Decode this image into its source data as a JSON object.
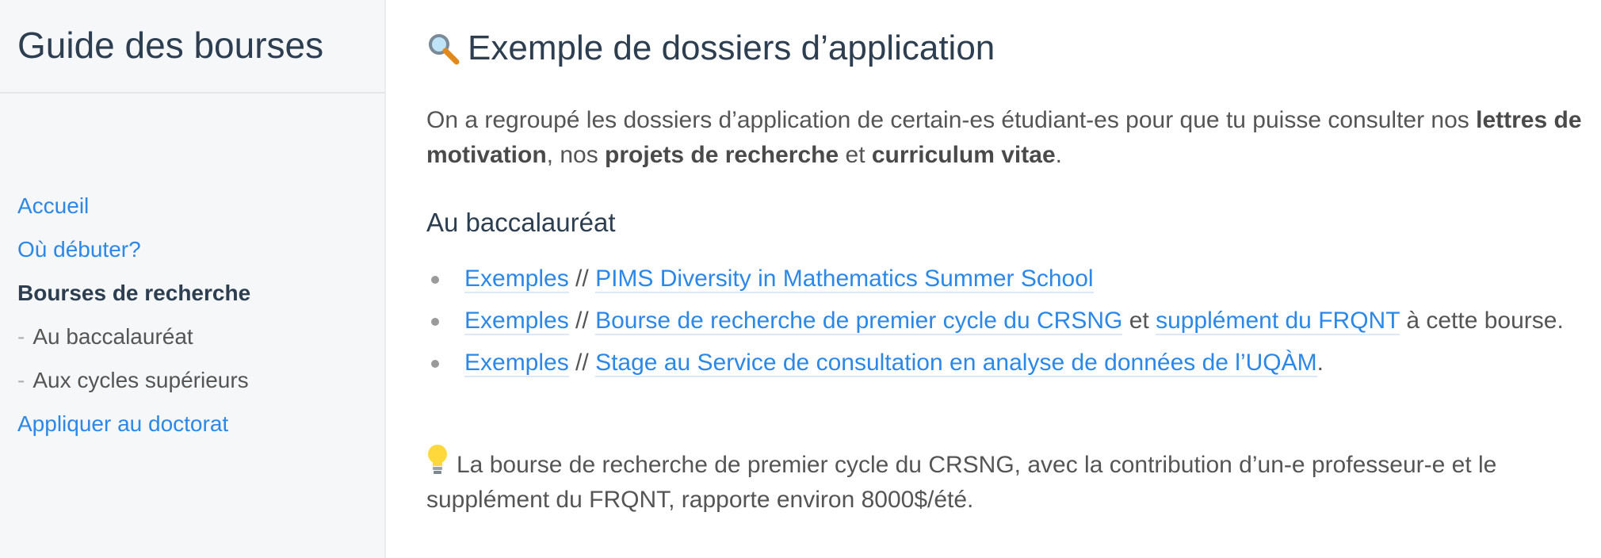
{
  "sidebar": {
    "site_title": "Guide des bourses",
    "items": [
      {
        "label": "Accueil"
      },
      {
        "label": "Où débuter?"
      },
      {
        "label": "Bourses de recherche"
      },
      {
        "label": "Au baccalauréat",
        "dash": "-"
      },
      {
        "label": "Aux cycles supérieurs",
        "dash": "-"
      },
      {
        "label": "Appliquer au doctorat"
      }
    ]
  },
  "main": {
    "title": "Exemple de dossiers d’application",
    "title_icon": "magnifier-icon",
    "intro": {
      "part1": "On a regroupé les dossiers d’application de certain-es étudiant-es pour que tu puisse consulter nos ",
      "bold1": "lettres de motivation",
      "part2": ", nos ",
      "bold2": "projets de recherche",
      "part3": " et ",
      "bold3": "curriculum vitae",
      "part4": "."
    },
    "section_title": "Au baccalauréat",
    "list": [
      {
        "examples": "Exemples",
        "sep": " // ",
        "link": "PIMS Diversity in Mathematics Summer School"
      },
      {
        "examples": "Exemples",
        "sep": " // ",
        "link": "Bourse de recherche de premier cycle du CRSNG",
        "mid": " et ",
        "link2": "supplément du FRQNT",
        "tail": " à cette bourse."
      },
      {
        "examples": "Exemples",
        "sep": " // ",
        "link": "Stage au Service de consultation en analyse de données de l’UQÀM",
        "tail": "."
      }
    ],
    "tip_icon": "lightbulb-icon",
    "tip_text": "La bourse de recherche de premier cycle du CRSNG, avec la contribution d’un-e professeur-e et le supplément du FRQNT, rapporte environ 8000$/été."
  },
  "colors": {
    "link": "#2b88e8",
    "heading": "#2c3e50",
    "text": "#555555",
    "sidebar_bg": "#f6f7f9"
  }
}
